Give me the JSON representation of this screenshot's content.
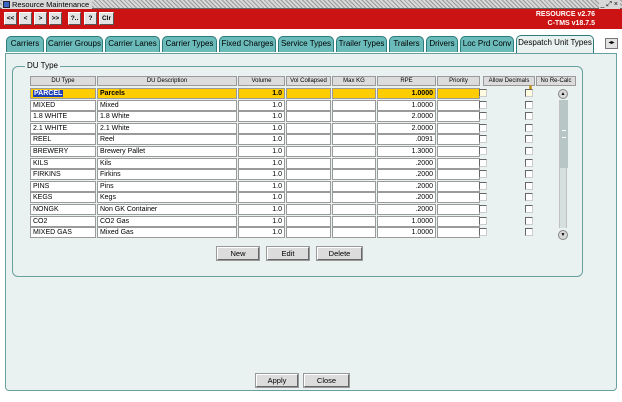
{
  "window": {
    "title": "Resource Maintenance",
    "controls": "_ ⤢ ×"
  },
  "toolbar": {
    "buttons": [
      "<<",
      "<",
      ">",
      ">>",
      "?..",
      "?",
      "Clr"
    ]
  },
  "brand": {
    "line1": "RESOURCE v2.76",
    "line2": "C-TMS v18.7.5"
  },
  "tabs": [
    {
      "label": "Carriers"
    },
    {
      "label": "Carrier Groups"
    },
    {
      "label": "Carrier Lanes"
    },
    {
      "label": "Carrier Types"
    },
    {
      "label": "Fixed Charges"
    },
    {
      "label": "Service Types"
    },
    {
      "label": "Trailer Types"
    },
    {
      "label": "Trailers"
    },
    {
      "label": "Drivers"
    },
    {
      "label": "Loc Prd Conv"
    },
    {
      "label": "Despatch Unit Types"
    }
  ],
  "tab_scroll": "◂▸",
  "group": {
    "title": "DU Type"
  },
  "columns": [
    "DU Type",
    "DU Description",
    "Volume",
    "Vol Collapsed",
    "Max KG",
    "RPE",
    "Priority",
    "Allow Decimals",
    "No Re-Calc"
  ],
  "rows": [
    {
      "code": "PARCEL",
      "desc": "Parcels",
      "volume": "1.0",
      "vol_collapsed": "",
      "max_kg": "",
      "rpe": "1.0000",
      "priority": "",
      "allow_decimals": false,
      "no_recalc": false
    },
    {
      "code": "MIXED",
      "desc": "Mixed",
      "volume": "1.0",
      "vol_collapsed": "",
      "max_kg": "",
      "rpe": "1.0000",
      "priority": "",
      "allow_decimals": false,
      "no_recalc": false
    },
    {
      "code": "1.8 WHITE",
      "desc": "1.8 White",
      "volume": "1.0",
      "vol_collapsed": "",
      "max_kg": "",
      "rpe": "2.0000",
      "priority": "",
      "allow_decimals": false,
      "no_recalc": false
    },
    {
      "code": "2.1 WHITE",
      "desc": "2.1 White",
      "volume": "1.0",
      "vol_collapsed": "",
      "max_kg": "",
      "rpe": "2.0000",
      "priority": "",
      "allow_decimals": false,
      "no_recalc": false
    },
    {
      "code": "REEL",
      "desc": "Reel",
      "volume": "1.0",
      "vol_collapsed": "",
      "max_kg": "",
      "rpe": ".0091",
      "priority": "",
      "allow_decimals": false,
      "no_recalc": false
    },
    {
      "code": "BREWERY",
      "desc": "Brewery Pallet",
      "volume": "1.0",
      "vol_collapsed": "",
      "max_kg": "",
      "rpe": "1.3000",
      "priority": "",
      "allow_decimals": false,
      "no_recalc": false
    },
    {
      "code": "KILS",
      "desc": "Kils",
      "volume": "1.0",
      "vol_collapsed": "",
      "max_kg": "",
      "rpe": ".2000",
      "priority": "",
      "allow_decimals": false,
      "no_recalc": false
    },
    {
      "code": "FIRKINS",
      "desc": "Firkins",
      "volume": "1.0",
      "vol_collapsed": "",
      "max_kg": "",
      "rpe": ".2000",
      "priority": "",
      "allow_decimals": false,
      "no_recalc": false
    },
    {
      "code": "PINS",
      "desc": "Pins",
      "volume": "1.0",
      "vol_collapsed": "",
      "max_kg": "",
      "rpe": ".2000",
      "priority": "",
      "allow_decimals": false,
      "no_recalc": false
    },
    {
      "code": "KEGS",
      "desc": "Kegs",
      "volume": "1.0",
      "vol_collapsed": "",
      "max_kg": "",
      "rpe": ".2000",
      "priority": "",
      "allow_decimals": false,
      "no_recalc": false
    },
    {
      "code": "NONGK",
      "desc": "Non GK Container",
      "volume": "1.0",
      "vol_collapsed": "",
      "max_kg": "",
      "rpe": ".2000",
      "priority": "",
      "allow_decimals": false,
      "no_recalc": false
    },
    {
      "code": "CO2",
      "desc": "CO2 Gas",
      "volume": "1.0",
      "vol_collapsed": "",
      "max_kg": "",
      "rpe": "1.0000",
      "priority": "",
      "allow_decimals": false,
      "no_recalc": false
    },
    {
      "code": "MIXED GAS",
      "desc": "Mixed Gas",
      "volume": "1.0",
      "vol_collapsed": "",
      "max_kg": "",
      "rpe": "1.0000",
      "priority": "",
      "allow_decimals": false,
      "no_recalc": false
    }
  ],
  "scrollbar": {
    "up": "▲",
    "down": "▼"
  },
  "grid_buttons": {
    "new": "New",
    "edit": "Edit",
    "delete": "Delete"
  },
  "footer": {
    "apply": "Apply",
    "close": "Close"
  },
  "colors": {
    "header_red": "#cc1313",
    "tab_teal": "#6bbbbb",
    "panel_bg": "#e9f2f1",
    "selected_row": "#ffcc00",
    "selected_code": "#1d3fb5"
  }
}
